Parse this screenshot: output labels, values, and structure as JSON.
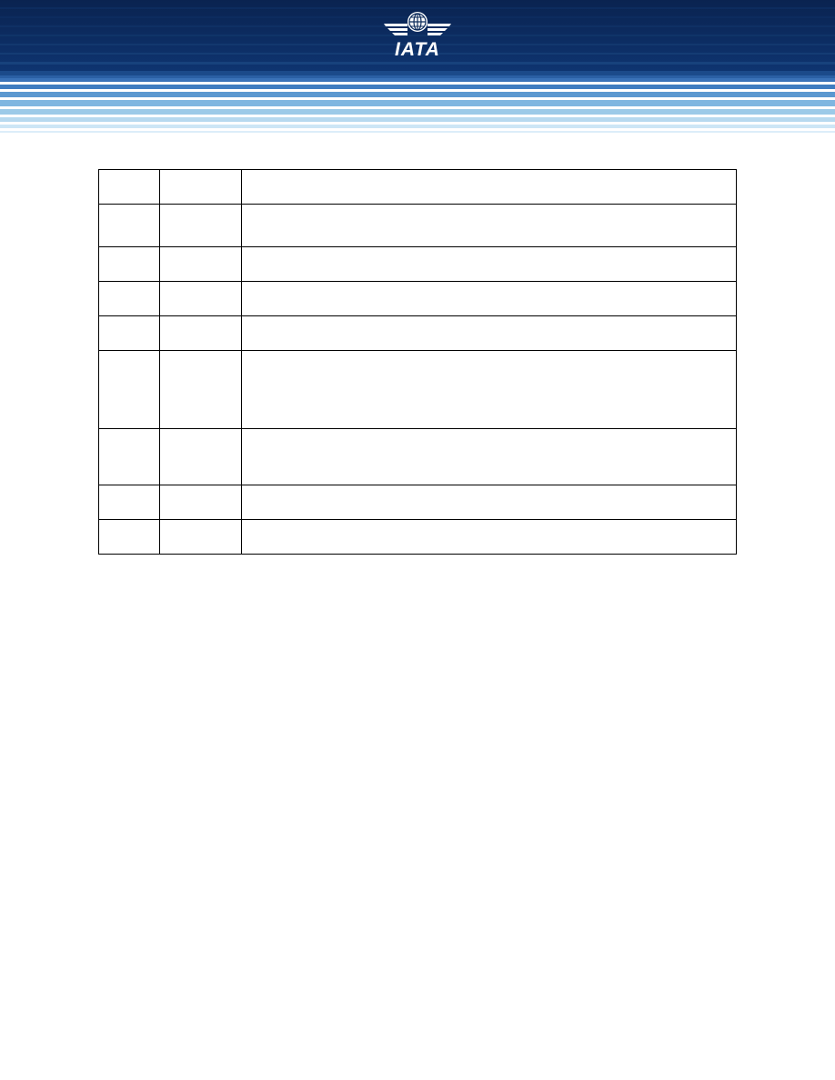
{
  "header": {
    "logo_text": "IATA",
    "logo_icon": "iata-globe-wings-icon",
    "colors": {
      "navy": "#0b2a5a",
      "mid_blue": "#2f63a8",
      "light_blue": "#8cc3e6",
      "pale_blue": "#d2ebf8"
    }
  },
  "table": {
    "rows": [
      {
        "cells": [
          "",
          "",
          ""
        ]
      },
      {
        "cells": [
          "",
          "",
          ""
        ]
      },
      {
        "cells": [
          "",
          "",
          ""
        ]
      },
      {
        "cells": [
          "",
          "",
          ""
        ]
      },
      {
        "cells": [
          "",
          "",
          ""
        ]
      },
      {
        "cells": [
          "",
          "",
          ""
        ]
      },
      {
        "cells": [
          "",
          "",
          ""
        ]
      },
      {
        "cells": [
          "",
          "",
          ""
        ]
      },
      {
        "cells": [
          "",
          "",
          ""
        ]
      }
    ]
  }
}
